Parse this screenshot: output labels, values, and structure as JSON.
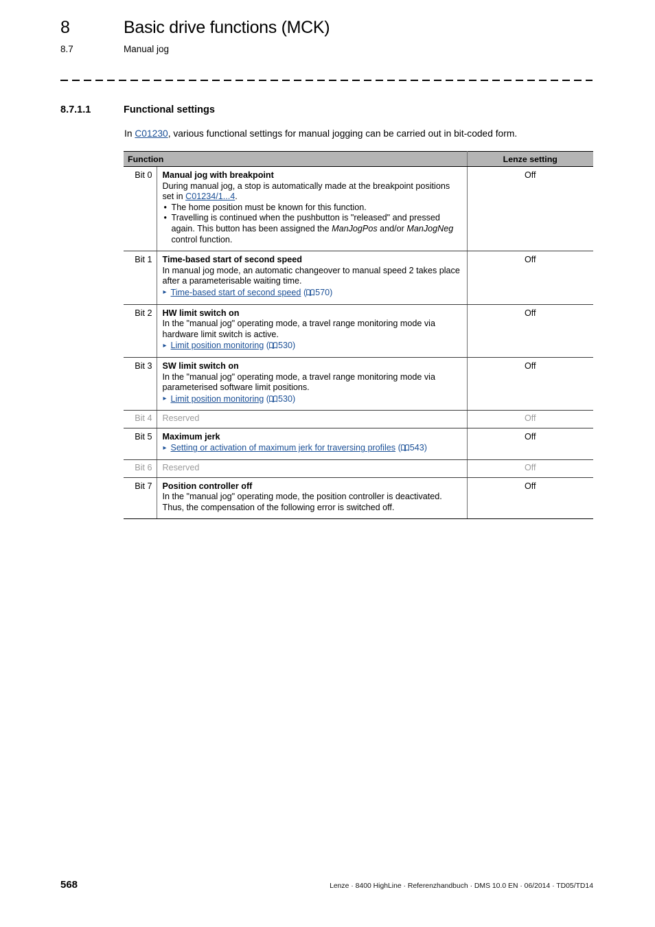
{
  "runhead": {
    "chapter_number": "8",
    "chapter_title": "Basic drive functions (MCK)",
    "section_number": "8.7",
    "section_title": "Manual jog"
  },
  "section": {
    "number": "8.7.1.1",
    "title": "Functional settings"
  },
  "intro": {
    "before_link": "In ",
    "link": "C01230",
    "after_link": ", various functional settings for manual jogging can be carried out in bit-coded form."
  },
  "table": {
    "headers": {
      "function": "Function",
      "setting": "Lenze setting"
    },
    "rows": [
      {
        "bit": "Bit 0",
        "title": "Manual jog with breakpoint",
        "body_before_link": "During manual jog, a stop is automatically made at the breakpoint positions set in ",
        "body_link": "C01234/1...4",
        "body_after_link": ".",
        "bullets": [
          "The home position must be known for this function.",
          "Travelling is continued when the pushbutton is \"released\" and pressed again. This button has been assigned the ManJogPos and/or ManJogNeg control function."
        ],
        "bullet2_parts": {
          "p1": "Travelling is continued when the pushbutton is \"released\" and pressed again. This button has been assigned the ",
          "i1": "ManJogPos",
          "p2": " and/or ",
          "i2": "ManJogNeg",
          "p3": " control function."
        },
        "value": "Off",
        "reserved": false
      },
      {
        "bit": "Bit 1",
        "title": "Time-based start of second speed",
        "body": "In manual jog mode, an automatic changeover to manual speed 2 takes place after a parameterisable waiting time.",
        "xref_label": "Time-based start of second speed",
        "xref_page": "570",
        "value": "Off",
        "reserved": false
      },
      {
        "bit": "Bit 2",
        "title": "HW limit switch on",
        "body": "In the \"manual jog\" operating mode, a travel range monitoring mode via hardware limit switch is active.",
        "xref_label": "Limit position monitoring",
        "xref_page": "530",
        "value": "Off",
        "reserved": false
      },
      {
        "bit": "Bit 3",
        "title": "SW limit switch on",
        "body": "In the \"manual jog\" operating mode, a travel range monitoring mode via parameterised software limit positions.",
        "xref_label": "Limit position monitoring",
        "xref_page": "530",
        "value": "Off",
        "reserved": false
      },
      {
        "bit": "Bit 4",
        "title": "Reserved",
        "value": "Off",
        "reserved": true
      },
      {
        "bit": "Bit 5",
        "title": "Maximum jerk",
        "xref_label": "Setting or activation of maximum jerk for traversing profiles",
        "xref_page": "543",
        "value": "Off",
        "reserved": false
      },
      {
        "bit": "Bit 6",
        "title": "Reserved",
        "value": "Off",
        "reserved": true
      },
      {
        "bit": "Bit 7",
        "title": "Position controller off",
        "body": "In the \"manual jog\" operating mode, the position controller is deactivated. Thus, the compensation of the following error is switched off.",
        "value": "Off",
        "reserved": false
      }
    ]
  },
  "footer": {
    "page_number": "568",
    "reference": "Lenze · 8400 HighLine · Referenzhandbuch · DMS 10.0 EN · 06/2014 · TD05/TD14"
  },
  "colors": {
    "link": "#1a4f96",
    "table_header_bg": "#b4b4b4",
    "reserved_text": "#9a9a9a"
  }
}
